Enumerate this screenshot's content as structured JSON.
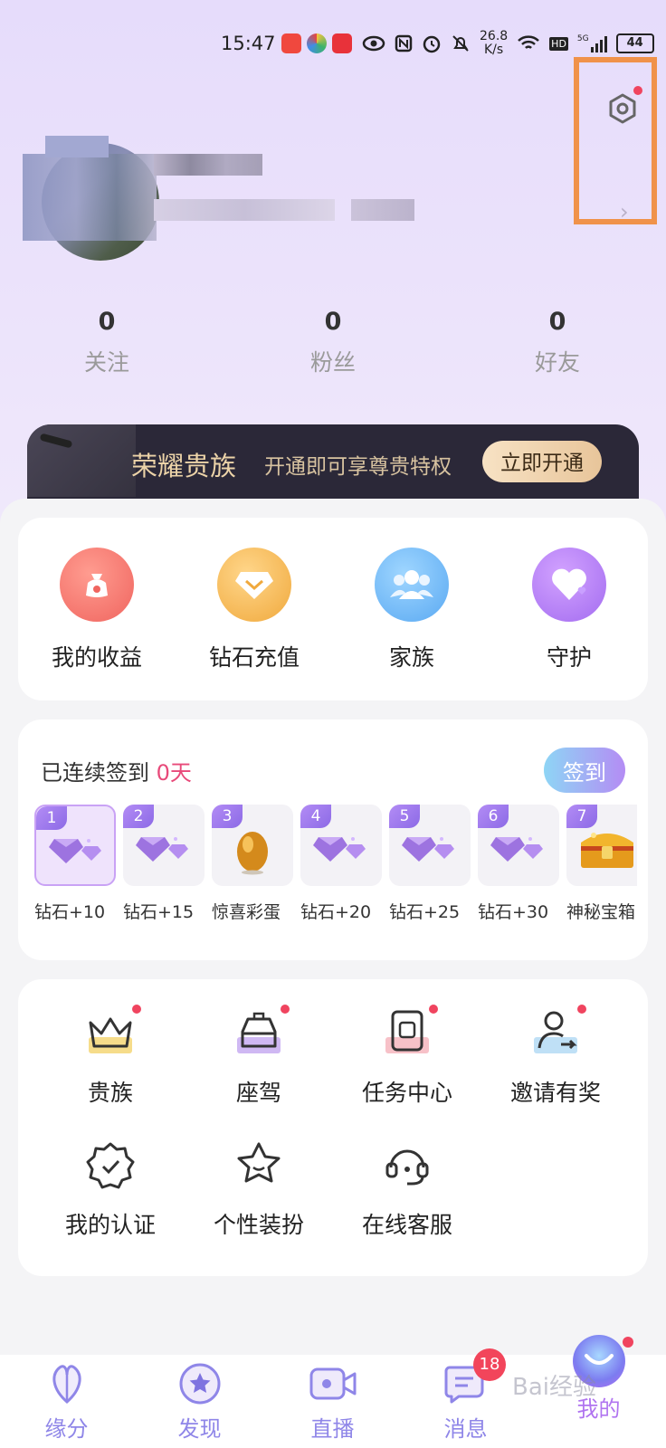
{
  "status_bar": {
    "time": "15:47",
    "net_speed_top": "26.8",
    "net_speed_bottom": "K/s",
    "hd": "HD",
    "net_gen": "5G",
    "battery": "44"
  },
  "profile": {},
  "stats": [
    {
      "count": "0",
      "label": "关注"
    },
    {
      "count": "0",
      "label": "粉丝"
    },
    {
      "count": "0",
      "label": "好友"
    }
  ],
  "vip_banner": {
    "title": "荣耀贵族",
    "subtitle": "开通即可享尊贵特权",
    "button": "立即开通"
  },
  "quick_actions": [
    {
      "label": "我的收益",
      "icon": "money-bag-icon",
      "color": "#f4736f"
    },
    {
      "label": "钻石充值",
      "icon": "diamond-icon",
      "color": "#f5b94f"
    },
    {
      "label": "家族",
      "icon": "group-icon",
      "color": "#6fb8f5"
    },
    {
      "label": "守护",
      "icon": "heart-icon",
      "color": "#b87ef2"
    }
  ],
  "checkin": {
    "title_prefix": "已连续签到",
    "days": "0天",
    "button": "签到",
    "days_list": [
      {
        "num": "1",
        "label": "钻石+10",
        "icon": "diamond-icon"
      },
      {
        "num": "2",
        "label": "钻石+15",
        "icon": "diamond-icon"
      },
      {
        "num": "3",
        "label": "惊喜彩蛋",
        "icon": "golden-egg-icon"
      },
      {
        "num": "4",
        "label": "钻石+20",
        "icon": "diamond-icon"
      },
      {
        "num": "5",
        "label": "钻石+25",
        "icon": "diamond-icon"
      },
      {
        "num": "6",
        "label": "钻石+30",
        "icon": "diamond-icon"
      },
      {
        "num": "7",
        "label": "神秘宝箱",
        "icon": "treasure-chest-icon"
      }
    ]
  },
  "features": [
    {
      "label": "贵族",
      "icon": "crown-icon",
      "dot": true
    },
    {
      "label": "座驾",
      "icon": "car-icon",
      "dot": true
    },
    {
      "label": "任务中心",
      "icon": "task-icon",
      "dot": true
    },
    {
      "label": "邀请有奖",
      "icon": "invite-user-icon",
      "dot": true
    },
    {
      "label": "我的认证",
      "icon": "verified-badge-icon",
      "dot": false
    },
    {
      "label": "个性装扮",
      "icon": "star-face-icon",
      "dot": false
    },
    {
      "label": "在线客服",
      "icon": "headset-icon",
      "dot": false
    }
  ],
  "tabbar": [
    {
      "label": "缘分",
      "icon": "fate-icon"
    },
    {
      "label": "发现",
      "icon": "discover-star-icon"
    },
    {
      "label": "直播",
      "icon": "live-camera-icon"
    },
    {
      "label": "消息",
      "icon": "message-icon",
      "badge": "18"
    },
    {
      "label": "我的",
      "icon": "mine-smile-icon",
      "active": true
    }
  ],
  "watermark": "Bai经验",
  "colors": {
    "accent": "#c07cf2",
    "active_tab": "#b074f0",
    "badge": "#f2455b",
    "highlight": "#f0924a"
  }
}
